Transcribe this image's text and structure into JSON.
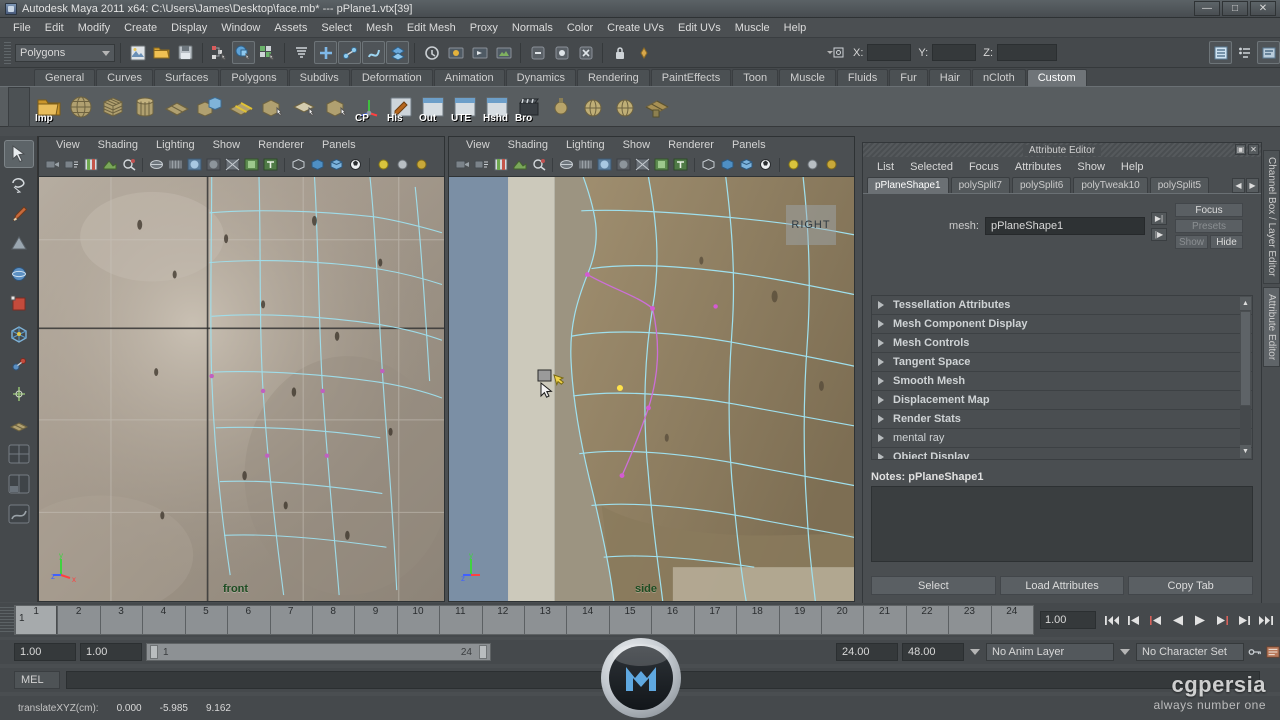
{
  "window": {
    "title": "Autodesk Maya 2011 x64: C:\\Users\\James\\Desktop\\face.mb*   ---   pPlane1.vtx[39]",
    "minimize": "—",
    "maximize": "□",
    "close": "✕"
  },
  "menubar": {
    "items": [
      "File",
      "Edit",
      "Modify",
      "Create",
      "Display",
      "Window",
      "Assets",
      "Select",
      "Mesh",
      "Edit Mesh",
      "Proxy",
      "Normals",
      "Color",
      "Create UVs",
      "Edit UVs",
      "Muscle",
      "Help"
    ]
  },
  "toolbar": {
    "mode_menu": "Polygons",
    "coord_labels": {
      "x": "X:",
      "y": "Y:",
      "z": "Z:"
    },
    "coord_values": {
      "x": "",
      "y": "",
      "z": ""
    }
  },
  "shelf": {
    "tabs": [
      "General",
      "Curves",
      "Surfaces",
      "Polygons",
      "Subdivs",
      "Deformation",
      "Animation",
      "Dynamics",
      "Rendering",
      "PaintEffects",
      "Toon",
      "Muscle",
      "Fluids",
      "Fur",
      "Hair",
      "nCloth",
      "Custom"
    ],
    "active_tab": "Custom",
    "item_labels": [
      "Imp",
      "",
      "",
      "",
      "",
      "",
      "",
      "",
      "",
      "",
      "CP",
      "His",
      "Out",
      "UTE",
      "Hshd",
      "Bro",
      "",
      "",
      "",
      ""
    ]
  },
  "panels": {
    "menu_items": [
      "View",
      "Shading",
      "Lighting",
      "Show",
      "Renderer",
      "Panels"
    ],
    "front_label": "front",
    "side_label": "side",
    "right_badge": "RIGHT",
    "axis_labels": {
      "x": "x",
      "y": "y",
      "z": "z"
    }
  },
  "attribute_editor": {
    "title": "Attribute Editor",
    "menu_items": [
      "List",
      "Selected",
      "Focus",
      "Attributes",
      "Show",
      "Help"
    ],
    "tabs": [
      "pPlaneShape1",
      "polySplit7",
      "polySplit6",
      "polyTweak10",
      "polySplit5"
    ],
    "active_tab": "pPlaneShape1",
    "mesh_label": "mesh:",
    "mesh_value": "pPlaneShape1",
    "focus_button": "Focus",
    "presets_button": "Presets",
    "show_button": "Show",
    "hide_button": "Hide",
    "sections": [
      "Tessellation Attributes",
      "Mesh Component Display",
      "Mesh Controls",
      "Tangent Space",
      "Smooth Mesh",
      "Displacement Map",
      "Render Stats",
      "mental ray",
      "Object Display"
    ],
    "notes_label": "Notes: pPlaneShape1",
    "notes_value": "",
    "bottom_buttons": [
      "Select",
      "Load Attributes",
      "Copy Tab"
    ]
  },
  "side_tabs": {
    "channel_box": "Channel Box / Layer Editor",
    "attribute_editor": "Attribute Editor"
  },
  "timeline": {
    "frames": [
      1,
      2,
      3,
      4,
      5,
      6,
      7,
      8,
      9,
      10,
      11,
      12,
      13,
      14,
      15,
      16,
      17,
      18,
      19,
      20,
      21,
      22,
      23,
      24
    ],
    "current_frame": "1",
    "current_frame_field": "1.00",
    "playback_buttons": [
      "go-to-start",
      "step-back-key",
      "step-back-frame",
      "play-backwards",
      "play-forwards",
      "step-forward-frame",
      "step-forward-key",
      "go-to-end"
    ]
  },
  "range_slider": {
    "anim_start": "1.00",
    "range_start": "1.00",
    "range_bar_start": "1",
    "range_bar_end": "24",
    "range_end": "24.00",
    "anim_end": "48.00",
    "anim_layer": "No Anim Layer",
    "character_set": "No Character Set"
  },
  "command_line": {
    "language": "MEL",
    "command_value": ""
  },
  "help_line": {
    "label": "translateXYZ(cm):",
    "x": "0.000",
    "y": "-5.985",
    "z": "9.162"
  },
  "watermark": {
    "brand": "cgpersia",
    "tagline": "always number one"
  },
  "colors": {
    "window_bg": "#4a4e51",
    "panel_bg": "#45494c",
    "accent_blue": "#5fa8e0",
    "mesh_wire": "#8fd8e8",
    "axis_x": "#ff4040",
    "axis_y": "#40ff40",
    "axis_z": "#4060ff",
    "timeline_track": "#8d9194"
  }
}
